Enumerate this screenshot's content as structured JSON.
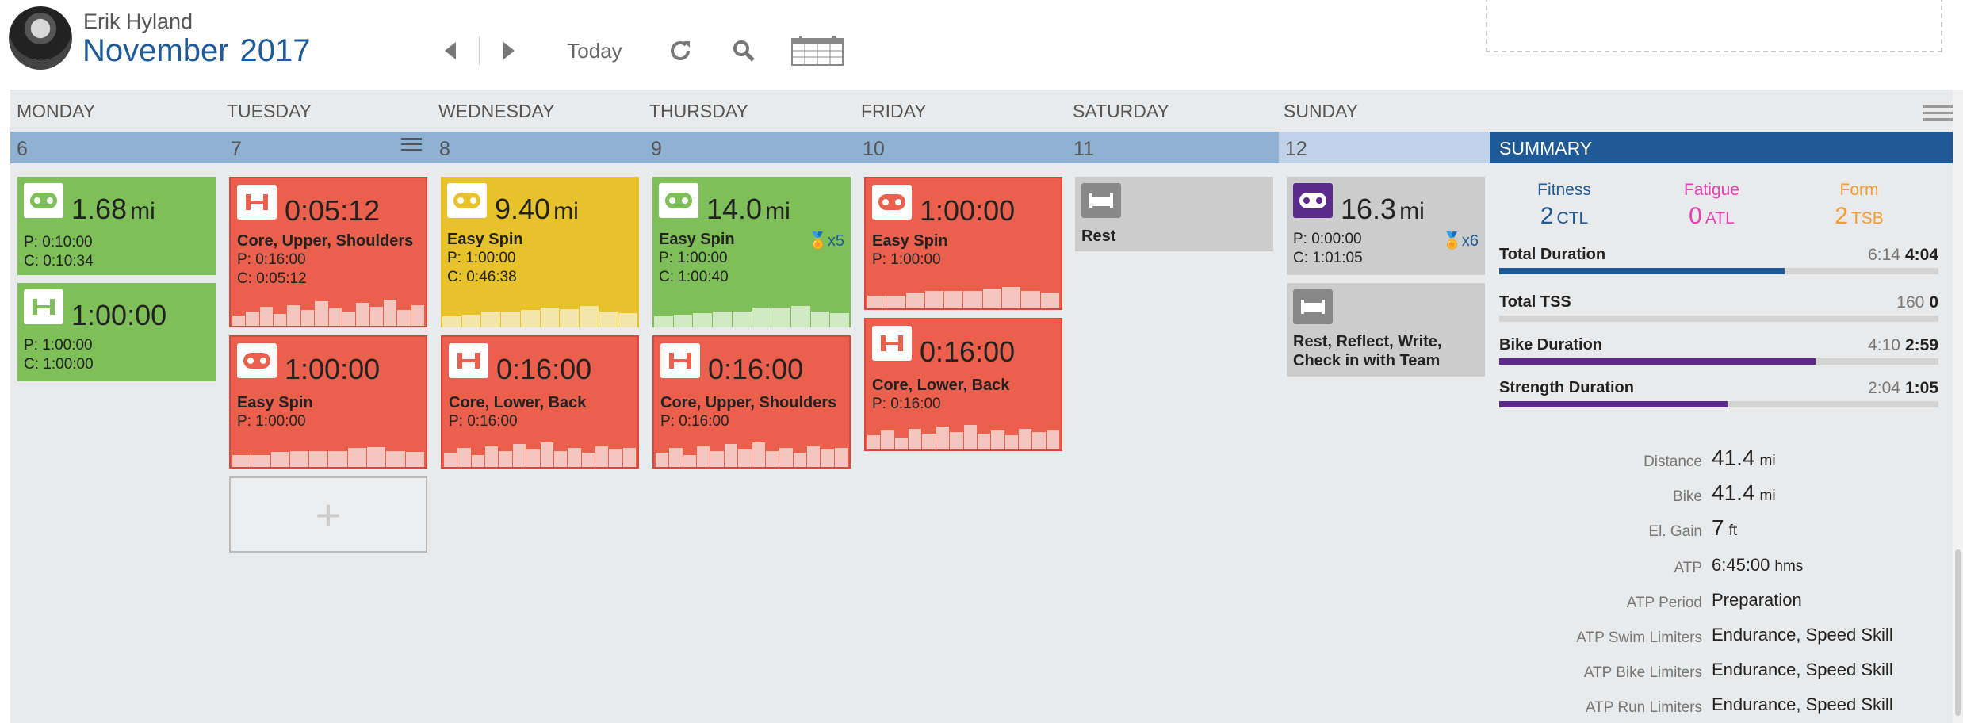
{
  "user": {
    "name": "Erik Hyland"
  },
  "header": {
    "month": "November",
    "year": "2017",
    "today_label": "Today"
  },
  "colors": {
    "accent": "#1f5a96",
    "green": "#7fbf59",
    "red": "#ea604c",
    "yellow": "#e8c22b",
    "fitness": "#1f5a96",
    "fatigue": "#e83fb5",
    "form": "#f39c33"
  },
  "days": [
    {
      "name": "MONDAY",
      "date": "6"
    },
    {
      "name": "TUESDAY",
      "date": "7"
    },
    {
      "name": "WEDNESDAY",
      "date": "8"
    },
    {
      "name": "THURSDAY",
      "date": "9"
    },
    {
      "name": "FRIDAY",
      "date": "10"
    },
    {
      "name": "SATURDAY",
      "date": "11"
    },
    {
      "name": "SUNDAY",
      "date": "12"
    }
  ],
  "workouts": {
    "mon1": {
      "icon": "bike-icon",
      "value": "1.68",
      "unit": "mi",
      "p": "P: 0:10:00",
      "c": "C: 0:10:34"
    },
    "mon2": {
      "icon": "strength-icon",
      "value": "1:00:00",
      "p": "P: 1:00:00",
      "c": "C: 1:00:00"
    },
    "tue1": {
      "icon": "strength-icon",
      "value": "0:05:12",
      "title": "Core, Upper, Shoulders",
      "p": "P: 0:16:00",
      "c": "C: 0:05:12"
    },
    "tue2": {
      "icon": "bike-icon",
      "value": "1:00:00",
      "title": "Easy Spin",
      "p": "P: 1:00:00"
    },
    "wed1": {
      "icon": "bike-icon",
      "value": "9.40",
      "unit": "mi",
      "title": "Easy Spin",
      "p": "P: 1:00:00",
      "c": "C: 0:46:38"
    },
    "wed2": {
      "icon": "strength-icon",
      "value": "0:16:00",
      "title": "Core, Lower, Back",
      "p": "P: 0:16:00"
    },
    "thu1": {
      "icon": "bike-icon",
      "value": "14.0",
      "unit": "mi",
      "title": "Easy Spin",
      "p": "P: 1:00:00",
      "c": "C: 1:00:40",
      "medal": "x5"
    },
    "thu2": {
      "icon": "strength-icon",
      "value": "0:16:00",
      "title": "Core, Upper, Shoulders",
      "p": "P: 0:16:00"
    },
    "fri1": {
      "icon": "bike-icon",
      "value": "1:00:00",
      "title": "Easy Spin",
      "p": "P: 1:00:00"
    },
    "fri2": {
      "icon": "strength-icon",
      "value": "0:16:00",
      "title": "Core, Lower, Back",
      "p": "P: 0:16:00"
    },
    "sat1": {
      "icon": "rest-icon",
      "title": "Rest"
    },
    "sun1": {
      "icon": "bike-icon",
      "value": "16.3",
      "unit": "mi",
      "p": "P: 0:00:00",
      "c": "C: 1:01:05",
      "medal": "x6"
    },
    "sun2": {
      "icon": "rest-icon",
      "title": "Rest, Reflect, Write, Check in with Team"
    }
  },
  "summary": {
    "title": "SUMMARY",
    "fitness": {
      "label": "Fitness",
      "value": "2",
      "unit": "CTL"
    },
    "fatigue": {
      "label": "Fatigue",
      "value": "0",
      "unit": "ATL"
    },
    "form": {
      "label": "Form",
      "value": "2",
      "unit": "TSB"
    },
    "metrics": [
      {
        "name": "Total Duration",
        "planned": "6:14",
        "actual": "4:04",
        "fraction": 0.65,
        "color": "#1f5a96"
      },
      {
        "name": "Total TSS",
        "planned": "160",
        "actual": "0",
        "fraction": 0.0,
        "color": "#1f5a96"
      },
      {
        "name": "Bike Duration",
        "planned": "4:10",
        "actual": "2:59",
        "fraction": 0.72,
        "color": "#5b2a8a"
      },
      {
        "name": "Strength Duration",
        "planned": "2:04",
        "actual": "1:05",
        "fraction": 0.52,
        "color": "#5b2a8a"
      }
    ],
    "stats": [
      {
        "label": "Distance",
        "value": "41.4",
        "unit": "mi"
      },
      {
        "label": "Bike",
        "value": "41.4",
        "unit": "mi"
      },
      {
        "label": "El. Gain",
        "value": "7",
        "unit": "ft"
      },
      {
        "label": "ATP",
        "value": "6:45:00",
        "unit": "hms"
      },
      {
        "label": "ATP Period",
        "value": "Preparation"
      },
      {
        "label": "ATP Swim Limiters",
        "value": "Endurance, Speed Skill"
      },
      {
        "label": "ATP Bike Limiters",
        "value": "Endurance, Speed Skill"
      },
      {
        "label": "ATP Run Limiters",
        "value": "Endurance, Speed Skill"
      }
    ]
  }
}
